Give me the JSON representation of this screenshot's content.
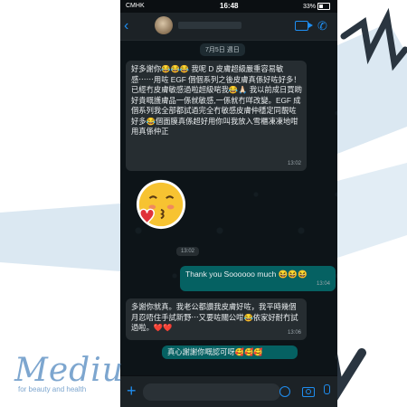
{
  "status_bar": {
    "carrier": "CMHK",
    "time": "16:48",
    "battery": "33%"
  },
  "chat": {
    "date": "7月5日 週日",
    "messages": [
      {
        "text": "好多謝你😂😂😂 我呢 D 皮膚超級嚴重容易敏感⋯⋯用咗 EGF 個個系列之後皮膚真係好咗好多！已經冇皮膚敏感過啦超級啱我😂🙏🏻 我以前成日買啲好貴嘅護膚品一係就敏感,一係就冇咩改變。EGF 成個系列我全部都試過完全冇敏感皮膚仲穩定同靚咗好多😂個面膜真係超好用你叫我放入雪櫃凍凍地咁用真係仲正",
        "time": "13:02"
      },
      {
        "sticker": "kissing-face-sticker",
        "time": "13:02"
      },
      {
        "text": "Thank you Soooooo much 😆😆😆",
        "time": "13:04"
      },
      {
        "text": "多謝你就真。我老公都讚我皮膚好咗，我平時幾個月忍唔住手試新野⋯又要咗關公咁😂依家好耐冇試過啦。❤️❤️",
        "time": "13:06"
      },
      {
        "text": "真心謝謝你嘅認可呀🥰🥰🥰"
      }
    ]
  },
  "brand": {
    "name": "Mediu",
    "tagline": "for beauty and health"
  },
  "colors": {
    "accent": "#1f8ef1",
    "bubble_out": "#056162",
    "bubble_in": "#262d31",
    "brand": "#7da6cf"
  }
}
